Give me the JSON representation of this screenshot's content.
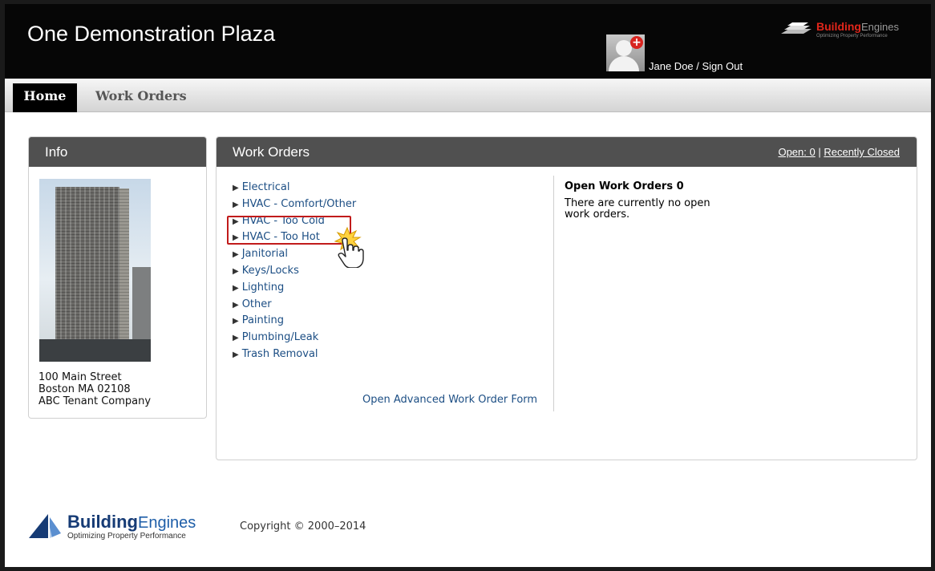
{
  "header": {
    "title": "One Demonstration Plaza",
    "user_name": "Jane Doe",
    "separator": " / ",
    "sign_out": "Sign Out",
    "logo_bold": "Building",
    "logo_light": "Engines",
    "logo_tagline": "Optimizing Property Performance"
  },
  "nav": {
    "tabs": [
      {
        "label": "Home",
        "active": true
      },
      {
        "label": "Work Orders",
        "active": false
      }
    ]
  },
  "info": {
    "title": "Info",
    "address_line1": "100 Main Street",
    "address_line2": "Boston MA 02108",
    "company": "ABC Tenant Company"
  },
  "work_orders": {
    "title": "Work Orders",
    "open_link": "Open: 0",
    "link_separator": " | ",
    "recent_link": "Recently Closed",
    "categories": [
      "Electrical",
      "HVAC - Comfort/Other",
      "HVAC - Too Cold",
      "HVAC - Too Hot",
      "Janitorial",
      "Keys/Locks",
      "Lighting",
      "Other",
      "Painting",
      "Plumbing/Leak",
      "Trash Removal"
    ],
    "advanced_form_link": "Open Advanced Work Order Form",
    "open_title": "Open Work Orders 0",
    "open_message": "There are currently no open work orders."
  },
  "footer": {
    "logo_bold": "Building",
    "logo_light": "Engines",
    "logo_tagline": "Optimizing Property Performance",
    "copyright": "Copyright © 2000–2014"
  },
  "colors": {
    "header_bg": "#060606",
    "panel_header": "#505050",
    "link": "#1c4e84",
    "highlight": "#c11b1b",
    "brand_red": "#e0261b",
    "brand_blue": "#163b75"
  }
}
